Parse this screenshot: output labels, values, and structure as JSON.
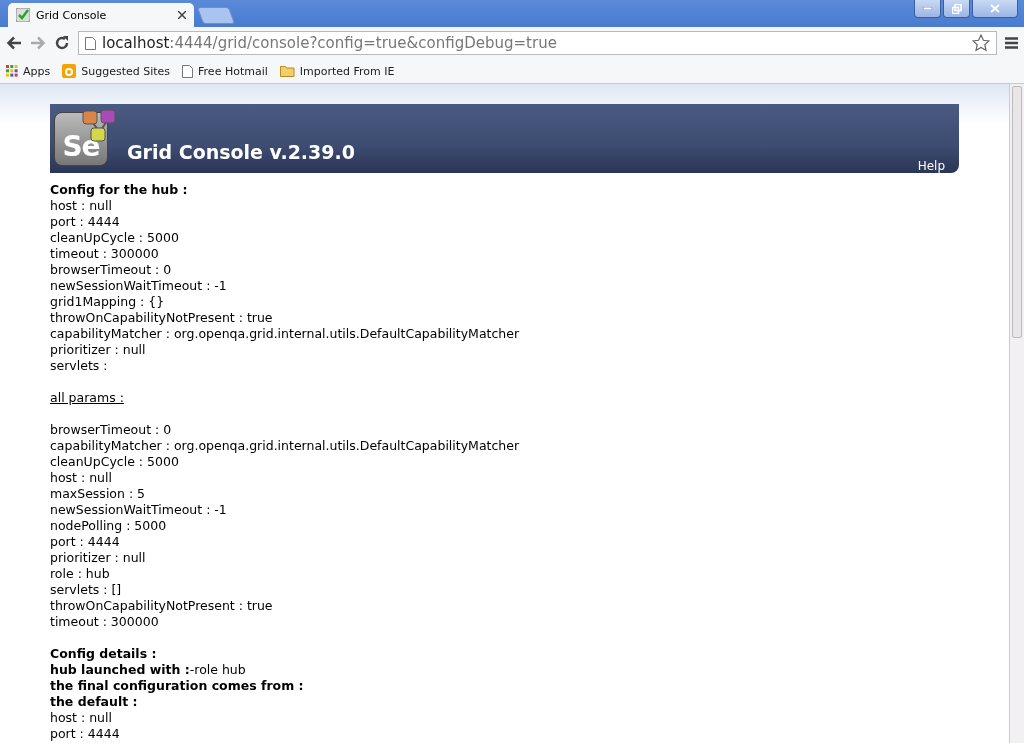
{
  "browser": {
    "tab": {
      "title": "Grid Console",
      "selected": true
    },
    "address": {
      "host": "localhost",
      "rest": ":4444/grid/console?config=true&configDebug=true"
    },
    "bookmarks": [
      {
        "kind": "apps",
        "label": "Apps"
      },
      {
        "kind": "site",
        "label": "Suggested Sites"
      },
      {
        "kind": "page",
        "label": "Free Hotmail"
      },
      {
        "kind": "folder",
        "label": "Imported From IE"
      }
    ]
  },
  "header": {
    "logo": "Se",
    "title": "Grid Console v.2.39.0",
    "help": "Help"
  },
  "lines": [
    {
      "kind": "heading",
      "text": "Config for the hub :"
    },
    {
      "kind": "line",
      "text": "host : null"
    },
    {
      "kind": "line",
      "text": "port : 4444"
    },
    {
      "kind": "line",
      "text": "cleanUpCycle : 5000"
    },
    {
      "kind": "line",
      "text": "timeout : 300000"
    },
    {
      "kind": "line",
      "text": "browserTimeout : 0"
    },
    {
      "kind": "line",
      "text": "newSessionWaitTimeout : -1"
    },
    {
      "kind": "line",
      "text": "grid1Mapping : {}"
    },
    {
      "kind": "line",
      "text": "throwOnCapabilityNotPresent : true"
    },
    {
      "kind": "line",
      "text": "capabilityMatcher : org.openqa.grid.internal.utils.DefaultCapabilityMatcher"
    },
    {
      "kind": "line",
      "text": "prioritizer : null"
    },
    {
      "kind": "line",
      "text": "servlets :"
    },
    {
      "kind": "blank"
    },
    {
      "kind": "link",
      "text": "all params :"
    },
    {
      "kind": "blank"
    },
    {
      "kind": "line",
      "text": "browserTimeout : 0"
    },
    {
      "kind": "line",
      "text": "capabilityMatcher : org.openqa.grid.internal.utils.DefaultCapabilityMatcher"
    },
    {
      "kind": "line",
      "text": "cleanUpCycle : 5000"
    },
    {
      "kind": "line",
      "text": "host : null"
    },
    {
      "kind": "line",
      "text": "maxSession : 5"
    },
    {
      "kind": "line",
      "text": "newSessionWaitTimeout : -1"
    },
    {
      "kind": "line",
      "text": "nodePolling : 5000"
    },
    {
      "kind": "line",
      "text": "port : 4444"
    },
    {
      "kind": "line",
      "text": "prioritizer : null"
    },
    {
      "kind": "line",
      "text": "role : hub"
    },
    {
      "kind": "line",
      "text": "servlets : []"
    },
    {
      "kind": "line",
      "text": "throwOnCapabilityNotPresent : true"
    },
    {
      "kind": "line",
      "text": "timeout : 300000"
    },
    {
      "kind": "blank"
    },
    {
      "kind": "heading",
      "text": "Config details :"
    },
    {
      "kind": "line",
      "text": "**hub launched with :**-role hub"
    },
    {
      "kind": "heading",
      "text": "the final configuration comes from :"
    },
    {
      "kind": "heading",
      "text": "the default :"
    },
    {
      "kind": "line",
      "text": "host : null"
    },
    {
      "kind": "line",
      "text": "port : 4444"
    }
  ]
}
